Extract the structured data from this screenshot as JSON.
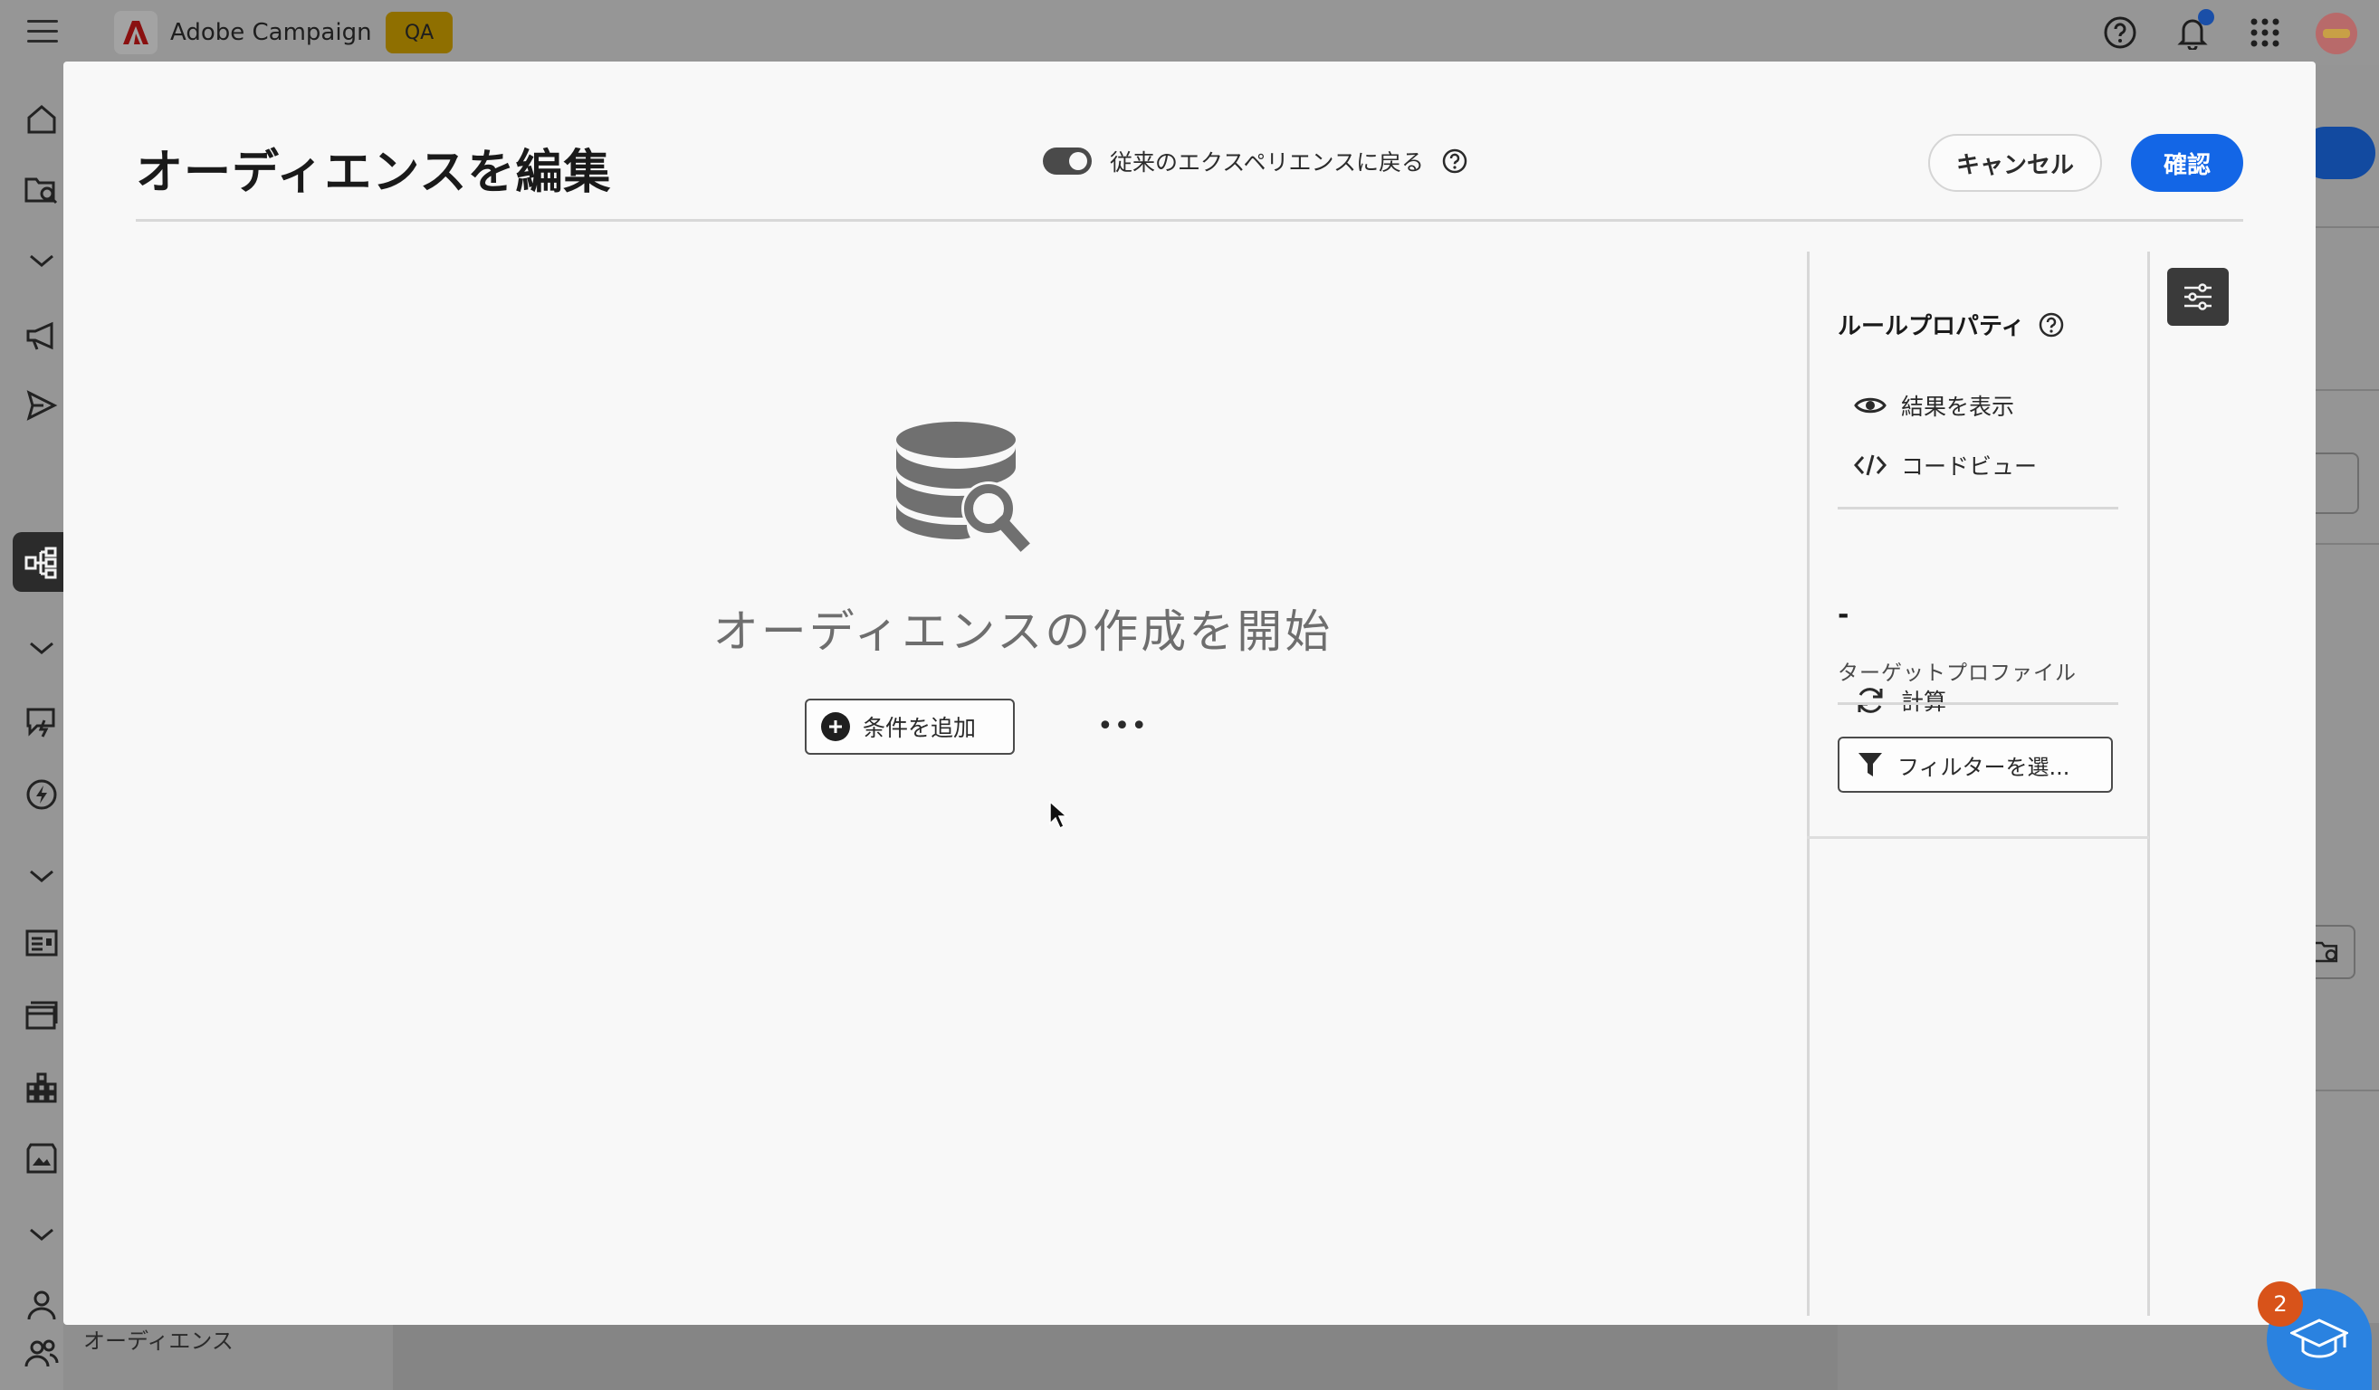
{
  "app": {
    "name": "Adobe Campaign",
    "env_badge": "QA"
  },
  "sidebar": {
    "visible_label": "オーディエンス"
  },
  "modal": {
    "title": "オーディエンスを編集",
    "toggle_label": "従来のエクスペリエンスに戻る",
    "toggle_on": true,
    "cancel_label": "キャンセル",
    "confirm_label": "確認",
    "empty_state_title": "オーディエンスの作成を開始",
    "add_condition_label": "条件を追加",
    "more_label": "•••"
  },
  "rule_panel": {
    "title": "ルールプロパティ",
    "show_results_label": "結果を表示",
    "code_view_label": "コードビュー",
    "target_value": "-",
    "target_label": "ターゲットプロファイル",
    "calculate_label": "計算",
    "filter_label": "フィルターを選..."
  },
  "learn": {
    "badge_count": "2"
  },
  "colors": {
    "primary": "#1366e6",
    "overlay_bg": "#8f8f8f",
    "modal_bg": "#f8f8f8",
    "qa_badge": "#8f6f00",
    "learn_fab": "#2a82e0",
    "learn_badge": "#d8531a"
  }
}
